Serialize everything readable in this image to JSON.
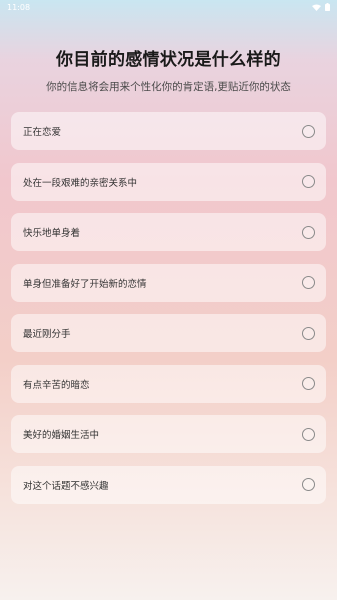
{
  "status_bar": {
    "time": "11:08"
  },
  "header": {
    "title": "你目前的感情状况是什么样的",
    "subtitle": "你的信息将会用来个性化你的肯定语,更贴近你的状态"
  },
  "options": [
    {
      "label": "正在恋爱"
    },
    {
      "label": "处在一段艰难的亲密关系中"
    },
    {
      "label": "快乐地单身着"
    },
    {
      "label": "单身但准备好了开始新的恋情"
    },
    {
      "label": "最近刚分手"
    },
    {
      "label": "有点辛苦的暗恋"
    },
    {
      "label": "美好的婚姻生活中"
    },
    {
      "label": "对这个话题不感兴趣"
    }
  ],
  "icons": {
    "wifi": "wifi-icon",
    "battery": "battery-icon",
    "radio": "radio-unchecked-icon"
  }
}
